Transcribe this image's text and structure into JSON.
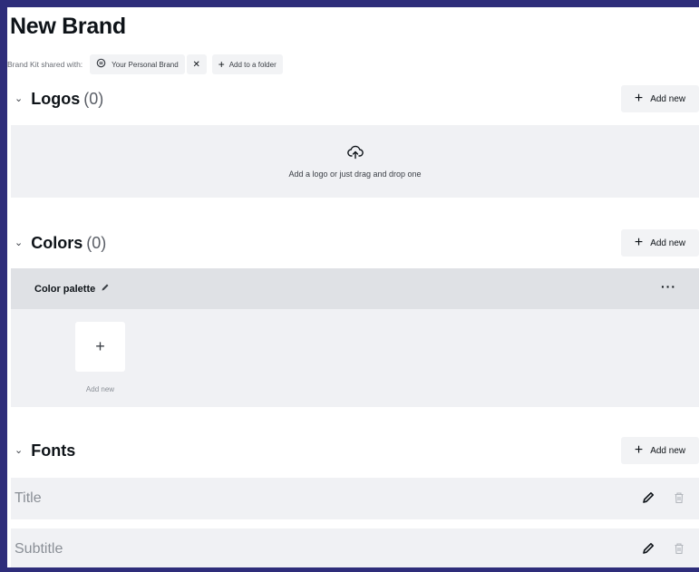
{
  "page": {
    "title": "New Brand"
  },
  "share": {
    "label": "Brand Kit shared with:",
    "brand_chip": "Your Personal Brand",
    "remove_symbol": "✕",
    "folder_button": "Add to a folder"
  },
  "logos": {
    "title": "Logos",
    "count": "(0)",
    "add_new": "Add new",
    "drop_text": "Add a logo or just drag and drop one"
  },
  "colors": {
    "title": "Colors",
    "count": "(0)",
    "add_new": "Add new",
    "palette_name": "Color palette",
    "more_symbol": "···",
    "swatch_add_label": "Add new"
  },
  "fonts": {
    "title": "Fonts",
    "add_new": "Add new",
    "rows": [
      {
        "name": "Title"
      },
      {
        "name": "Subtitle"
      }
    ]
  },
  "colors_theme": {
    "border": "#2e2d7a",
    "panel": "#f0f1f4",
    "palette_header": "#dfe1e5",
    "button": "#f2f3f5"
  },
  "icons": {
    "chevron": "chevron-down-icon",
    "upload": "cloud-upload-icon",
    "edit": "pencil-icon",
    "delete": "trash-icon",
    "brand": "brand-icon"
  }
}
